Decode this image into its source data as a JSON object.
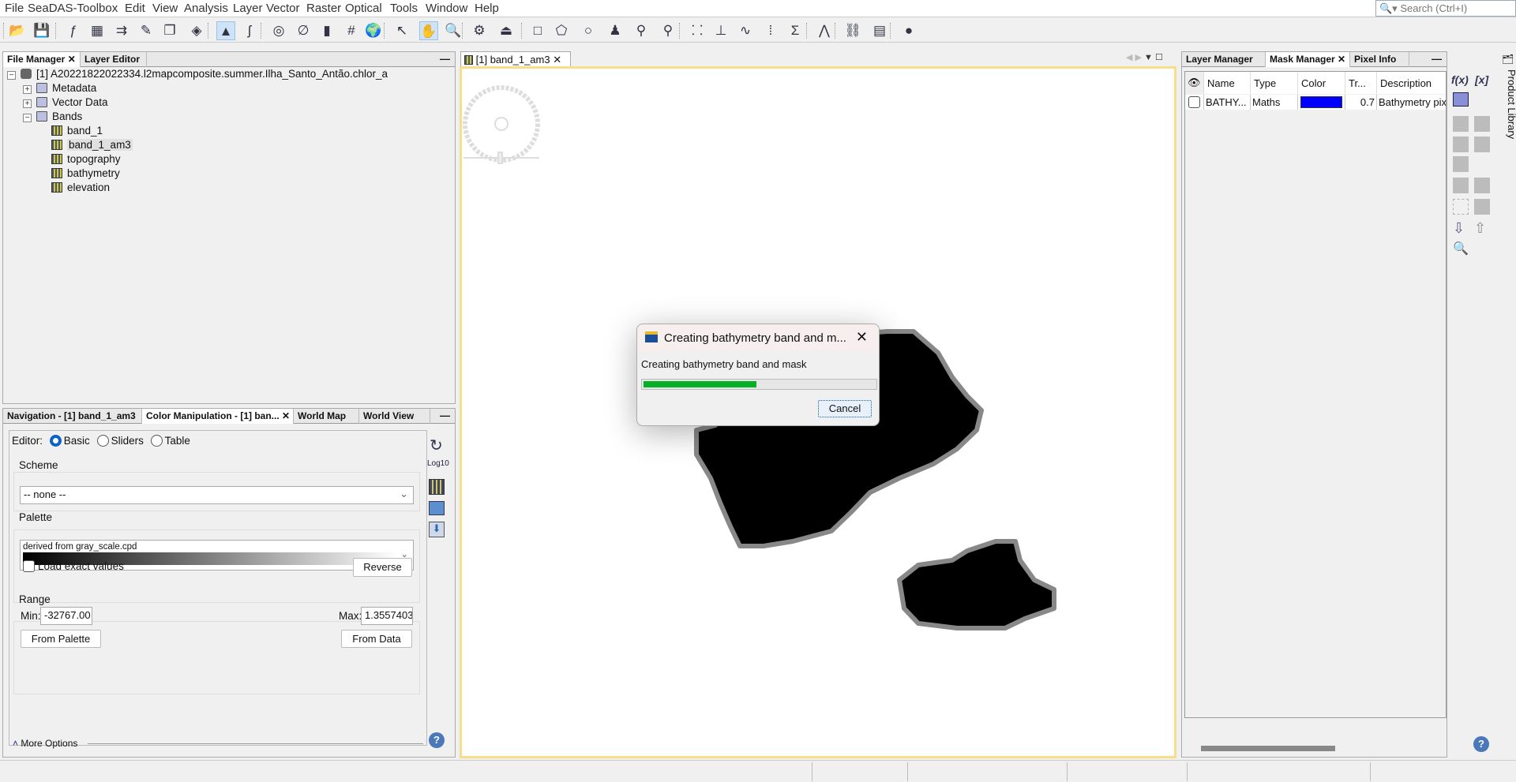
{
  "menu": [
    "File",
    "SeaDAS-Toolbox",
    "Edit",
    "View",
    "Analysis",
    "Layer",
    "Vector",
    "Raster",
    "Optical",
    "Tools",
    "Window",
    "Help"
  ],
  "search": {
    "placeholder": "Search (Ctrl+I)"
  },
  "toolbar": {
    "icons": [
      {
        "name": "open-product-icon",
        "glyph": "📂"
      },
      {
        "name": "save-product-icon",
        "glyph": "💾"
      },
      {
        "name": "band-maths-icon",
        "glyph": "ƒ"
      },
      {
        "name": "grid-icon",
        "glyph": "▦"
      },
      {
        "name": "transfer-icon",
        "glyph": "⇉"
      },
      {
        "name": "edit-icon",
        "glyph": "✎"
      },
      {
        "name": "mosaic-icon",
        "glyph": "❐"
      },
      {
        "name": "reprojection-icon",
        "glyph": "◈"
      },
      {
        "name": "image-view-icon",
        "glyph": "▲",
        "on": true
      },
      {
        "name": "vector-icon",
        "glyph": "ʃ"
      },
      {
        "name": "fingerprint-icon",
        "glyph": "◎"
      },
      {
        "name": "no-data-icon",
        "glyph": "∅"
      },
      {
        "name": "color-bar-icon",
        "glyph": "▮"
      },
      {
        "name": "graticule-icon",
        "glyph": "#"
      },
      {
        "name": "world-icon",
        "glyph": "🌍"
      },
      {
        "name": "select-tool-icon",
        "glyph": "↖"
      },
      {
        "name": "pan-tool-icon",
        "glyph": "✋",
        "on": true
      },
      {
        "name": "zoom-tool-icon",
        "glyph": "🔍"
      },
      {
        "name": "pin-manager-icon",
        "glyph": "⚙"
      },
      {
        "name": "import-vector-icon",
        "glyph": "⏏"
      },
      {
        "name": "rectangle-tool-icon",
        "glyph": "□"
      },
      {
        "name": "polygon-tool-icon",
        "glyph": "⬠"
      },
      {
        "name": "ellipse-tool-icon",
        "glyph": "○"
      },
      {
        "name": "pin-tool-icon",
        "glyph": "♟"
      },
      {
        "name": "range-finder-icon",
        "glyph": "⚲"
      },
      {
        "name": "gcp-tool-icon",
        "glyph": "⚲"
      },
      {
        "name": "scatter-plot-icon",
        "glyph": "⸬"
      },
      {
        "name": "histogram-icon",
        "glyph": "⊥"
      },
      {
        "name": "profile-plot-icon",
        "glyph": "∿"
      },
      {
        "name": "correlative-plot-icon",
        "glyph": "⁞"
      },
      {
        "name": "statistics-icon",
        "glyph": "Σ"
      },
      {
        "name": "spectrum-icon",
        "glyph": "⋀"
      },
      {
        "name": "graph-builder-icon",
        "glyph": "⛓"
      },
      {
        "name": "batch-processing-icon",
        "glyph": "▤"
      },
      {
        "name": "rgb-image-icon",
        "glyph": "●"
      }
    ]
  },
  "left_top": {
    "tabs": [
      "File Manager",
      "Layer Editor"
    ],
    "product": "[1] A20221822022334.l2mapcomposite.summer.Ilha_Santo_Antão.chlor_a",
    "folders": [
      "Metadata",
      "Vector Data",
      "Bands"
    ],
    "bands": [
      "band_1",
      "band_1_am3",
      "topography",
      "bathymetry",
      "elevation"
    ],
    "selected_band": "band_1_am3"
  },
  "left_bottom": {
    "tabs": [
      "Navigation - [1] band_1_am3",
      "Color Manipulation - [1] ban...",
      "World Map",
      "World View"
    ],
    "editor_label": "Editor:",
    "editor_options": [
      "Basic",
      "Sliders",
      "Table"
    ],
    "editor_selected": "Basic",
    "scheme_label": "Scheme",
    "scheme_value": "-- none --",
    "palette_label": "Palette",
    "palette_value": "derived from gray_scale.cpd",
    "load_exact": "Load exact values",
    "load_exact_checked": false,
    "reverse": "Reverse",
    "range_label": "Range",
    "min_label": "Min:",
    "min_value": "-32767.00",
    "max_label": "Max:",
    "max_value": "1.3557403",
    "from_palette": "From Palette",
    "from_data": "From Data",
    "log_label": "Log10",
    "more_options": "More Options"
  },
  "view": {
    "tab": "[1] band_1_am3"
  },
  "dialog": {
    "title": "Creating bathymetry band and m...",
    "message": "Creating bathymetry band and mask",
    "progress_percent": 48,
    "cancel": "Cancel",
    "progress_color": "#06b025"
  },
  "right": {
    "tabs": [
      "Layer Manager",
      "Mask Manager",
      "Pixel Info"
    ],
    "columns": [
      "Name",
      "Type",
      "Color",
      "Tr...",
      "Description"
    ],
    "rows": [
      {
        "name": "BATHY...",
        "type": "Maths",
        "color": "#0000ff",
        "transparency": "0.7",
        "description": "Bathymetry pixels"
      }
    ],
    "fx": "f(x)",
    "x": "[x]",
    "product_library": "Product Library"
  }
}
